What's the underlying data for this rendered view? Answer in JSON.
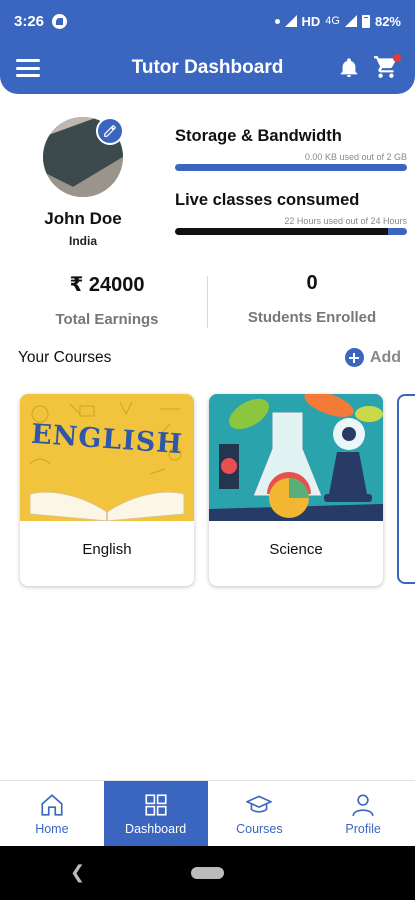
{
  "status_bar": {
    "time": "3:26",
    "network": "HD",
    "network_type": "4G",
    "battery": "82%"
  },
  "header": {
    "title": "Tutor Dashboard"
  },
  "profile": {
    "name": "John Doe",
    "country": "India"
  },
  "usage": [
    {
      "title": "Storage & Bandwidth",
      "detail": "0.00 KB used out of 2 GB",
      "progress": 0.0
    },
    {
      "title": "Live classes consumed",
      "detail": "22 Hours used out of 24 Hours",
      "progress": 0.917
    }
  ],
  "stats": {
    "earnings": {
      "value": "₹ 24000",
      "label": "Total Earnings"
    },
    "students": {
      "value": "0",
      "label": "Students Enrolled"
    }
  },
  "courses_section": {
    "title": "Your Courses",
    "add_label": "Add"
  },
  "courses": [
    {
      "name": "English",
      "image_text": "ENGLISH"
    },
    {
      "name": "Science"
    }
  ],
  "bottom_nav": [
    {
      "label": "Home",
      "icon": "home-icon"
    },
    {
      "label": "Dashboard",
      "icon": "dashboard-icon",
      "active": true
    },
    {
      "label": "Courses",
      "icon": "graduation-cap-icon"
    },
    {
      "label": "Profile",
      "icon": "person-icon"
    }
  ],
  "colors": {
    "primary": "#3a66bf",
    "notification": "#e53935"
  }
}
